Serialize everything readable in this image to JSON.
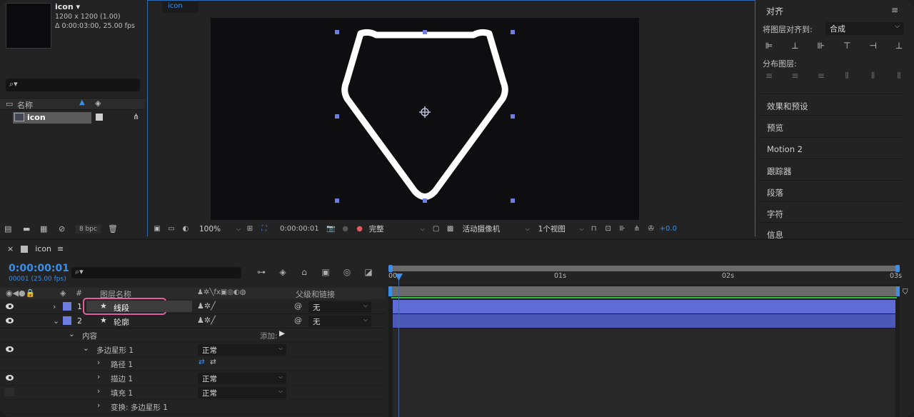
{
  "project": {
    "comp_name": "icon",
    "comp_size": "1200 x 1200 (1.00)",
    "comp_duration": "Δ 0:00:03:00, 25.00 fps",
    "col_name": "名称",
    "item_name": "icon",
    "bpc": "8 bpc"
  },
  "viewer": {
    "tab": "icon",
    "zoom": "100%",
    "timecode": "0:00:00:01",
    "resolution": "完整",
    "camera": "活动摄像机",
    "views": "1个视图",
    "exposure": "+0.0"
  },
  "align": {
    "title": "对齐",
    "align_to_label": "将图层对齐到:",
    "align_to_value": "合成",
    "distribute_label": "分布图层:"
  },
  "panels": [
    "效果和预设",
    "预览",
    "Motion 2",
    "跟踪器",
    "段落",
    "字符",
    "信息"
  ],
  "timeline": {
    "tab": "icon",
    "time": "0:00:00:01",
    "frames": "00001 (25.00 fps)",
    "col_layer_name": "图层名称",
    "col_parent": "父级和链接",
    "col_num": "#",
    "ruler": [
      "00s",
      "01s",
      "02s",
      "03s"
    ],
    "layers": [
      {
        "num": "1",
        "name": "线段",
        "parent": "无"
      },
      {
        "num": "2",
        "name": "轮廓",
        "parent": "无"
      }
    ],
    "contents_label": "内容",
    "add_label": "添加:",
    "props": [
      {
        "name": "多边星形 1",
        "value": "正常"
      },
      {
        "name": "路径 1",
        "value": ""
      },
      {
        "name": "描边 1",
        "value": "正常"
      },
      {
        "name": "填充 1",
        "value": "正常"
      },
      {
        "name": "变换: 多边星形 1",
        "value": ""
      }
    ]
  },
  "colors": {
    "accent": "#3d8ee6",
    "layer_label": "#6f7de0",
    "highlight": "#e2609a"
  }
}
